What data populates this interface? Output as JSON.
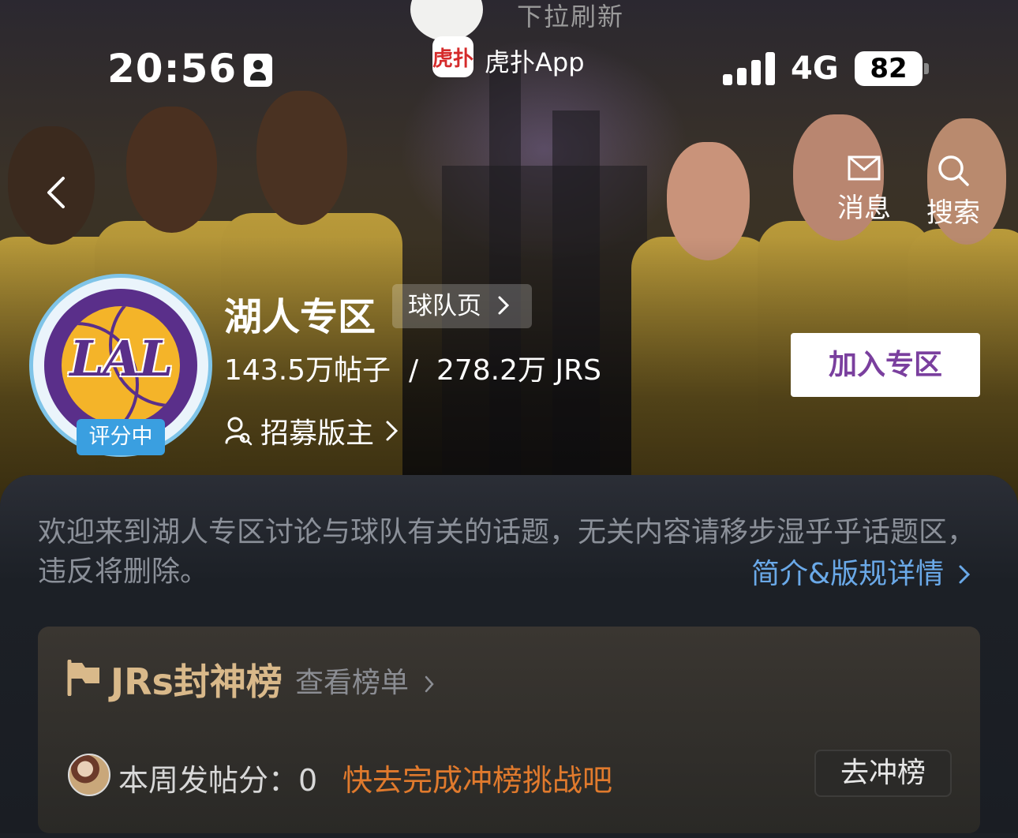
{
  "pull_refresh": "下拉刷新",
  "status_bar": {
    "time": "20:56",
    "app_badge": "虎扑",
    "app_name": "虎扑App",
    "network": "4G",
    "battery": "82"
  },
  "header_actions": {
    "messages_label": "消息",
    "search_label": "搜索"
  },
  "zone": {
    "logo_text": "LAL",
    "rating_badge": "评分中",
    "title": "湖人专区",
    "team_page_label": "球队页",
    "stats": "143.5万帖子  /  278.2万 JRS",
    "recruit_label": "招募版主",
    "join_label": "加入专区"
  },
  "intro": {
    "description": "欢迎来到湖人专区讨论与球队有关的话题，无关内容请移步湿乎乎话题区，违反将删除。",
    "detail_link": "简介&版规详情"
  },
  "ranking": {
    "title": "JRs封神榜",
    "view_list": "查看榜单",
    "week_score_label": "本周发帖分：",
    "week_score_value": "0",
    "challenge_text": "快去完成冲榜挑战吧",
    "rank_button": "去冲榜"
  },
  "colors": {
    "accent_purple": "#7a3f9e",
    "link_blue": "#6aa9e8",
    "challenge_orange": "#e07a2d",
    "rank_gold": "#d9b98a",
    "rating_blue": "#3a9fe0"
  }
}
